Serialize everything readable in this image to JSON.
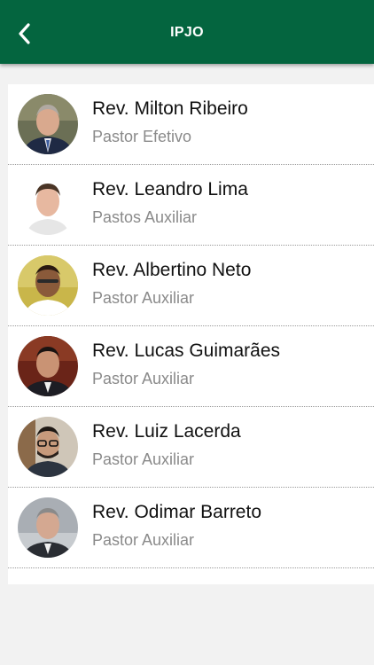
{
  "header": {
    "title": "IPJO",
    "back_icon": "chevron-left-icon",
    "background": "#04653f"
  },
  "pastors": [
    {
      "name": "Rev. Milton Ribeiro",
      "role": "Pastor Efetivo"
    },
    {
      "name": "Rev. Leandro Lima",
      "role": "Pastos Auxiliar"
    },
    {
      "name": "Rev. Albertino Neto",
      "role": "Pastor Auxiliar"
    },
    {
      "name": "Rev. Lucas Guimarães",
      "role": "Pastor Auxiliar"
    },
    {
      "name": "Rev. Luiz Lacerda",
      "role": "Pastor Auxiliar"
    },
    {
      "name": "Rev. Odimar Barreto",
      "role": "Pastor Auxiliar"
    }
  ]
}
